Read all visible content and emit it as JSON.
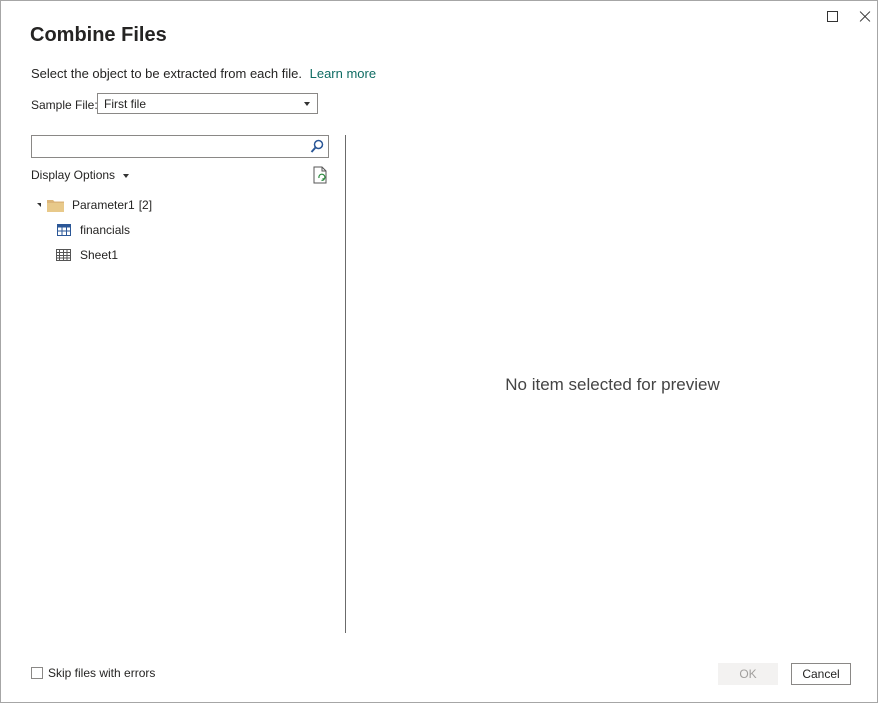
{
  "dialog": {
    "title": "Combine Files",
    "subtitle": "Select the object to be extracted from each file.",
    "learn_more": "Learn more"
  },
  "sample_file": {
    "label": "Sample File:",
    "value": "First file"
  },
  "search": {
    "placeholder": ""
  },
  "display_options": "Display Options",
  "tree": {
    "root": {
      "name": "Parameter1",
      "count": "[2]",
      "icon": "folder-icon"
    },
    "items": [
      {
        "name": "financials",
        "icon": "table-icon"
      },
      {
        "name": "Sheet1",
        "icon": "sheet-icon"
      }
    ]
  },
  "preview": {
    "message": "No item selected for preview"
  },
  "footer": {
    "skip_label": "Skip files with errors",
    "skip_checked": false,
    "ok_label": "OK",
    "cancel_label": "Cancel"
  },
  "colors": {
    "link": "#0f6c63",
    "folder": "#dcb67a",
    "table_icon": "#2b5797",
    "disabled_button_bg": "#f3f2f1"
  }
}
